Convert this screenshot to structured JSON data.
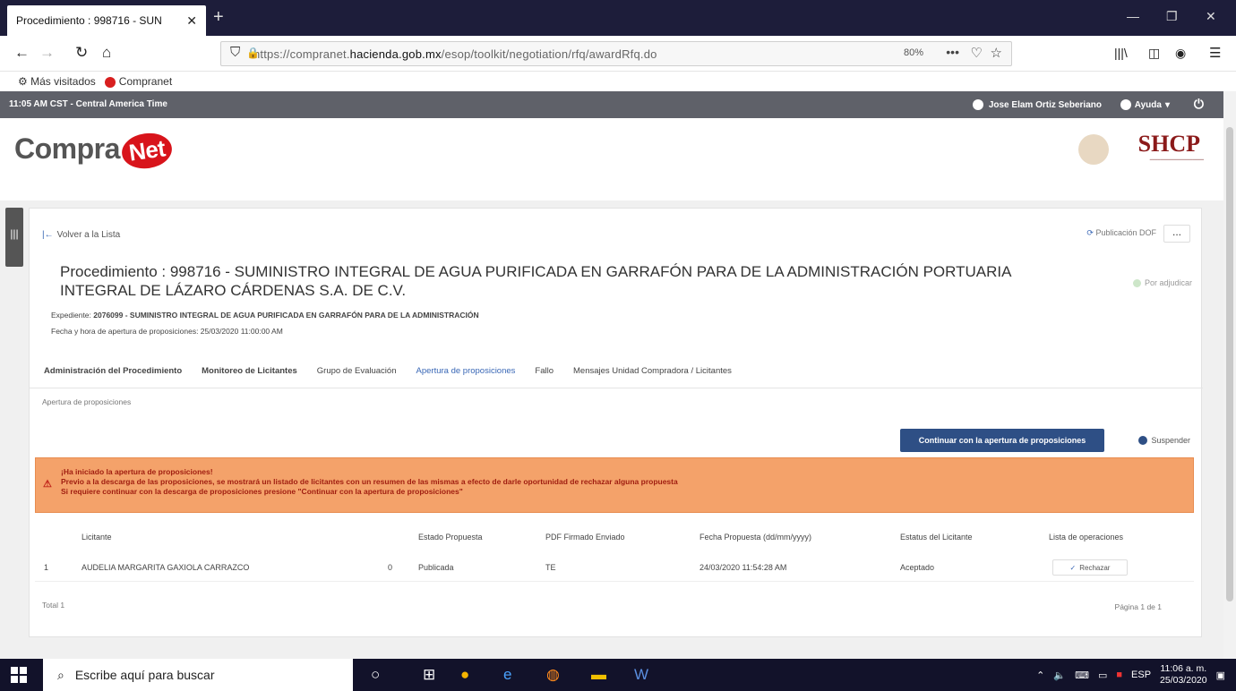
{
  "browser": {
    "tab_title": "Procedimiento : 998716 - SUN",
    "url_scheme": "https://compranet.",
    "url_host": "hacienda.gob.mx",
    "url_path": "/esop/toolkit/negotiation/rfq/awardRfq.do",
    "zoom": "80%",
    "bookmarks": [
      "Más visitados",
      "Compranet"
    ]
  },
  "topbar": {
    "clock": "11:05 AM CST - Central America Time",
    "user": "Jose Elam Ortiz Seberiano",
    "help": "Ayuda"
  },
  "header": {
    "logo_main": "Compra",
    "logo_net": "Net",
    "agency": "SHCP"
  },
  "card": {
    "back": "Volver a la Lista",
    "publicacion": "Publicación DOF",
    "more": "...",
    "title": "Procedimiento : 998716 - SUMINISTRO INTEGRAL DE AGUA PURIFICADA EN GARRAFÓN PARA DE LA ADMINISTRACIÓN PORTUARIA INTEGRAL DE LÁZARO CÁRDENAS S.A. DE C.V.",
    "status": "Por adjudicar",
    "expediente_label": "Expediente: ",
    "expediente_value": "2076099 - SUMINISTRO INTEGRAL DE AGUA PURIFICADA EN GARRAFÓN PARA DE LA ADMINISTRACIÓN",
    "fecha": "Fecha y hora de apertura de proposiciones: 25/03/2020 11:00:00 AM",
    "tabs": [
      "Administración del Procedimiento",
      "Monitoreo de Licitantes",
      "Grupo de Evaluación",
      "Apertura de proposiciones",
      "Fallo",
      "Mensajes Unidad Compradora / Licitantes"
    ],
    "subtab": "Apertura de proposiciones",
    "continuar": "Continuar con la apertura de proposiciones",
    "suspender": "Suspender",
    "alert": [
      "¡Ha iniciado la apertura de proposiciones!",
      "Previo a la descarga de las proposiciones, se mostrará un listado de licitantes con un resumen de las mismas a efecto de darle oportunidad de rechazar alguna propuesta",
      "Si requiere continuar con la descarga de proposiciones presione \"Continuar con la apertura de proposiciones\""
    ],
    "table": {
      "headers": [
        "Licitante",
        "Estado Propuesta",
        "PDF Firmado Enviado",
        "Fecha Propuesta (dd/mm/yyyy)",
        "Estatus del Licitante",
        "Lista de operaciones"
      ],
      "rows": [
        {
          "index": "1",
          "licitante": "AUDELIA MARGARITA GAXIOLA CARRAZCO",
          "count": "0",
          "estado": "Publicada",
          "pdf": "TE",
          "fecha": "24/03/2020 11:54:28 AM",
          "estatus": "Aceptado",
          "operacion": "Rechazar"
        }
      ]
    },
    "total": "Total 1",
    "pagina": "Página 1 de 1"
  },
  "taskbar": {
    "search_placeholder": "Escribe aquí para buscar",
    "lang": "ESP",
    "time": "11:06 a. m.",
    "date": "25/03/2020"
  }
}
